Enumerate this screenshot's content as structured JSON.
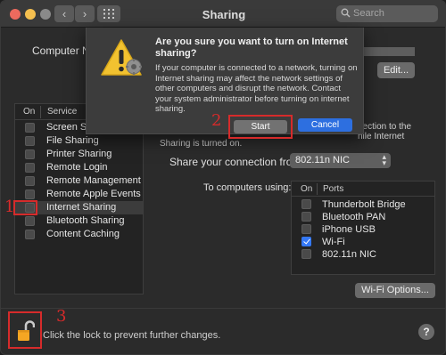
{
  "window": {
    "title": "Sharing",
    "back_glyph": "‹",
    "forward_glyph": "›",
    "search_placeholder": "Search"
  },
  "computer_name": {
    "label": "Computer Na",
    "edit_label": "Edit..."
  },
  "services": {
    "header_on": "On",
    "header_service": "Service",
    "items": [
      {
        "label": "Screen Shar",
        "checked": false
      },
      {
        "label": "File Sharing",
        "checked": false
      },
      {
        "label": "Printer Sharing",
        "checked": false
      },
      {
        "label": "Remote Login",
        "checked": false
      },
      {
        "label": "Remote Management",
        "checked": false
      },
      {
        "label": "Remote Apple Events",
        "checked": false
      },
      {
        "label": "Internet Sharing",
        "checked": false,
        "selected": true
      },
      {
        "label": "Bluetooth Sharing",
        "checked": false
      },
      {
        "label": "Content Caching",
        "checked": false
      }
    ]
  },
  "details": {
    "desc_line1": "nection to the",
    "desc_line2": "hile Internet",
    "desc_line3": "Sharing is turned on.",
    "share_from_label": "Share your connection from:",
    "share_from_value": "802.11n NIC",
    "to_computers_label": "To computers using:",
    "ports_header_on": "On",
    "ports_header_ports": "Ports",
    "ports": [
      {
        "label": "Thunderbolt Bridge",
        "checked": false
      },
      {
        "label": "Bluetooth PAN",
        "checked": false
      },
      {
        "label": "iPhone USB",
        "checked": false
      },
      {
        "label": "Wi-Fi",
        "checked": true
      },
      {
        "label": "802.11n NIC",
        "checked": false
      }
    ],
    "wifi_options_label": "Wi-Fi Options..."
  },
  "footer": {
    "lock_text": "Click the lock to prevent further changes.",
    "help_label": "?"
  },
  "dialog": {
    "title": "Are you sure you want to turn on Internet sharing?",
    "body": "If your computer is connected to a network, turning on Internet sharing may affect the network settings of other computers and disrupt the network. Contact your system administrator before turning on internet sharing.",
    "start_label": "Start",
    "cancel_label": "Cancel"
  },
  "annotations": {
    "step1": "1",
    "step2": "2",
    "step3": "3"
  },
  "colors": {
    "accent_blue": "#2d6fe0",
    "annotation_red": "#d62b2b",
    "lock_orange": "#f5a623"
  }
}
